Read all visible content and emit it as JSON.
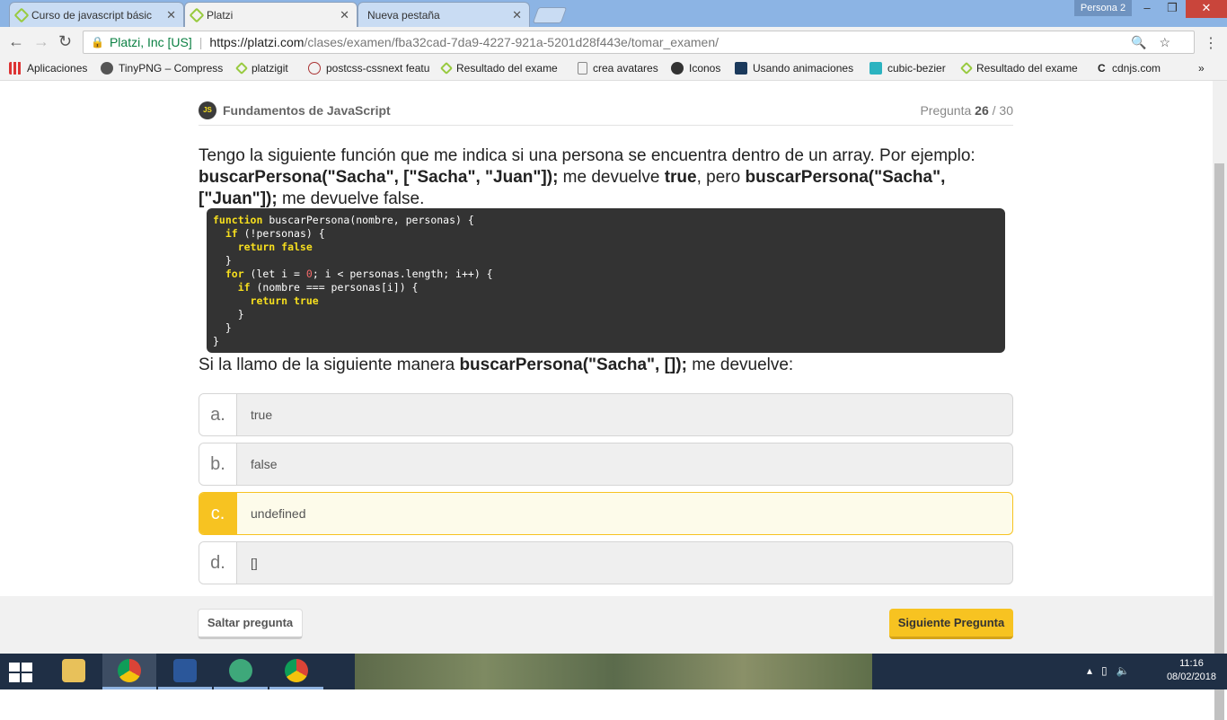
{
  "browser": {
    "tabs": [
      {
        "title": "Curso de javascript básic"
      },
      {
        "title": "Platzi"
      },
      {
        "title": "Nueva pestaña"
      }
    ],
    "profile": "Persona 2",
    "address": {
      "security_label": "Platzi, Inc [US]",
      "url_scheme_host": "https://platzi.com",
      "url_path": "/clases/examen/fba32cad-7da9-4227-921a-5201d28f443e/tomar_examen/"
    },
    "bookmarks": [
      {
        "label": "Aplicaciones"
      },
      {
        "label": "TinyPNG – Compress"
      },
      {
        "label": "platzigit"
      },
      {
        "label": "postcss-cssnext featu"
      },
      {
        "label": "Resultado del exame"
      },
      {
        "label": "crea avatares"
      },
      {
        "label": "Iconos"
      },
      {
        "label": "Usando animaciones"
      },
      {
        "label": "cubic-bezier"
      },
      {
        "label": "Resultado del exame"
      },
      {
        "label": "cdnjs.com"
      }
    ]
  },
  "exam": {
    "course": "Fundamentos de JavaScript",
    "question_label": "Pregunta",
    "question_current": "26",
    "question_total": "/ 30",
    "logo_text": "JS",
    "q": {
      "t1": "Tengo la siguiente función que me indica si una persona se encuentra dentro de un array. Por ejemplo: ",
      "b1": "buscarPersona(\"Sacha\", [\"Sacha\", \"Juan\"]);",
      "t2": " me devuelve ",
      "b2": "true",
      "t3": ", pero ",
      "b3": "buscarPersona(\"Sacha\", [\"Juan\"]);",
      "t4": " me devuelve false."
    },
    "q2": {
      "t1": "Si la llamo de la siguiente manera ",
      "b1": "buscarPersona(\"Sacha\", []);",
      "t2": " me devuelve:"
    },
    "options": [
      {
        "letter": "a.",
        "text": "true",
        "selected": false
      },
      {
        "letter": "b.",
        "text": "false",
        "selected": false
      },
      {
        "letter": "c.",
        "text": "undefined",
        "selected": true
      },
      {
        "letter": "d.",
        "text": "[]",
        "selected": false
      }
    ],
    "skip_label": "Saltar pregunta",
    "next_label": "Siguiente Pregunta"
  },
  "code": {
    "l1k": "function",
    "l1": " buscarPersona(nombre, personas) {",
    "l2k": "  if",
    "l2": " (!personas) {",
    "l3k": "    return false",
    "l3": "",
    "l4": "  }",
    "l5k": "  for",
    "l5a": " (let i = ",
    "l5n": "0",
    "l5b": "; i < personas.length; i++) {",
    "l6k": "    if",
    "l6": " (nombre === personas[i]) {",
    "l7k": "      return true",
    "l7": "",
    "l8": "    }",
    "l9": "  }",
    "l10": "}"
  },
  "taskbar": {
    "time": "11:16",
    "date": "08/02/2018",
    "apps": [
      "file-explorer",
      "chrome",
      "word",
      "atom",
      "chrome"
    ]
  }
}
